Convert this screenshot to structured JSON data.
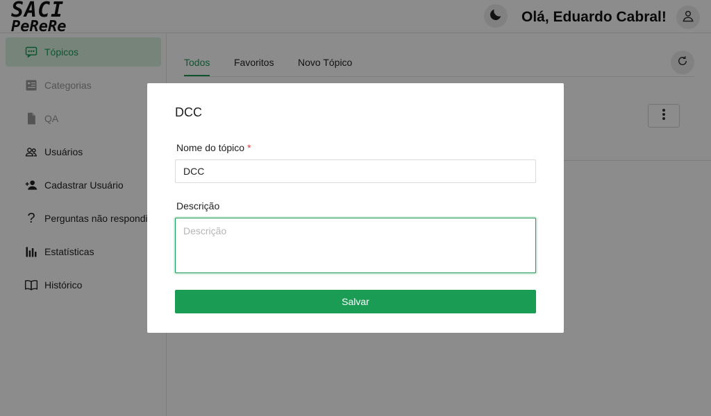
{
  "header": {
    "logo_line1": "SACI",
    "logo_line2": "PeReRe",
    "greeting": "Olá, Eduardo Cabral!",
    "theme_icon": "moon-icon",
    "user_icon": "user-icon"
  },
  "sidebar": {
    "items": [
      {
        "label": "Tópicos",
        "icon": "chat-icon",
        "state": "active"
      },
      {
        "label": "Categorias",
        "icon": "list-icon",
        "state": "disabled"
      },
      {
        "label": "QA",
        "icon": "file-icon",
        "state": "disabled"
      },
      {
        "label": "Usuários",
        "icon": "users-icon",
        "state": "normal"
      },
      {
        "label": "Cadastrar Usuário",
        "icon": "user-add-icon",
        "state": "normal"
      },
      {
        "label": "Perguntas não respondi...",
        "icon": "question-icon",
        "state": "normal"
      },
      {
        "label": "Estatísticas",
        "icon": "bar-chart-icon",
        "state": "normal"
      },
      {
        "label": "Histórico",
        "icon": "book-icon",
        "state": "normal"
      }
    ]
  },
  "main": {
    "tabs": [
      {
        "label": "Todos",
        "active": true
      },
      {
        "label": "Favoritos",
        "active": false
      },
      {
        "label": "Novo Tópico",
        "active": false
      }
    ]
  },
  "modal": {
    "title": "DCC",
    "name_label": "Nome do tópico",
    "required_mark": "*",
    "name_value": "DCC",
    "description_label": "Descrição",
    "description_placeholder": "Descrição",
    "save_label": "Salvar"
  },
  "colors": {
    "accent": "#1a9c55",
    "active_bg": "#d9f0df",
    "required": "#e53935"
  }
}
